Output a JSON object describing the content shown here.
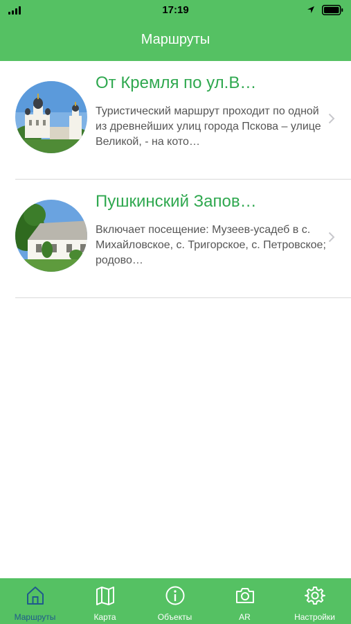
{
  "status_bar": {
    "time": "17:19"
  },
  "header": {
    "title": "Маршруты"
  },
  "routes": [
    {
      "title": "От Кремля по ул.В…",
      "description": "Туристический маршрут проходит по одной из древнейших улиц города Пскова – улице Великой, - на  кото…"
    },
    {
      "title": "Пушкинский Запов…",
      "description": "Включает посещение: Музеев-усадеб в с. Михайловское, с. Тригорское, с. Петровское; родово…"
    }
  ],
  "tabbar": {
    "tabs": [
      {
        "label": "Маршруты",
        "icon": "home-icon",
        "active": true
      },
      {
        "label": "Карта",
        "icon": "map-icon"
      },
      {
        "label": "Объекты",
        "icon": "info-icon"
      },
      {
        "label": "AR",
        "icon": "camera-icon"
      },
      {
        "label": "Настройки",
        "icon": "gear-icon"
      }
    ]
  },
  "colors": {
    "accent": "#55c163",
    "title_green": "#2fa84f",
    "active_tab": "#1f5a8c"
  }
}
